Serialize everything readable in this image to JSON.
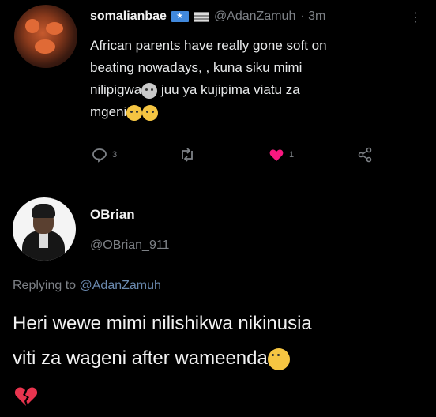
{
  "tweet": {
    "username": "somalianbae",
    "handle": "@AdanZamuh",
    "time": "· 3m",
    "text_line1": "African parents have really gone soft on",
    "text_line2": "beating nowadays, , kuna siku mimi",
    "text_line3a": "nilipigwa",
    "text_line3b": " juu ya kujipima viatu za",
    "text_line4": "mgeni",
    "reply_count": "3",
    "like_count": "1"
  },
  "reply": {
    "name": "OBrian",
    "handle": "@OBrian_911",
    "replying_prefix": "Replying to ",
    "replying_to": "@AdanZamuh",
    "text_line1": "Heri wewe mimi nilishikwa nikinusia",
    "text_line2": "viti za wageni after wameenda"
  },
  "colors": {
    "background": "#000000",
    "muted": "#7d8186",
    "like": "#f91880"
  },
  "icons": [
    "more-icon",
    "reply-icon",
    "retweet-icon",
    "like-icon",
    "share-icon",
    "broken-heart-icon"
  ]
}
